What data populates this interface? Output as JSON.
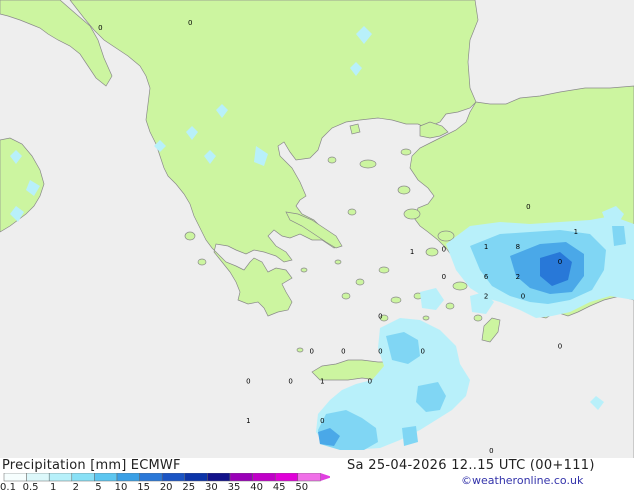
{
  "title": "Precipitation [mm]  ECMWF",
  "datetime": "Sa 25-04-2026 12..15 UTC (00+111)",
  "credit": "©weatheronline.co.uk",
  "colors": {
    "sea": "#eeeeee",
    "land": "#ccf5a0",
    "coast": "#8a8a8a",
    "precip_light": "#b8f0fa",
    "precip_medium": "#80d6f4",
    "precip_strong": "#4aa8e8",
    "precip_heavy": "#2878d8"
  },
  "legend": {
    "labels": [
      "0.1",
      "0.5",
      "1",
      "2",
      "5",
      "10",
      "15",
      "20",
      "25",
      "30",
      "35",
      "40",
      "45",
      "50"
    ],
    "colors": [
      "#f6fefe",
      "#dcf8fb",
      "#b6f0fa",
      "#88e0f6",
      "#5cc6f0",
      "#3aa0e6",
      "#2a78d8",
      "#1a54c4",
      "#0c34a8",
      "#12128a",
      "#9a00b8",
      "#c000c8",
      "#e000d8",
      "#f070e8"
    ]
  },
  "point_values": [
    {
      "label": "1",
      "lon": 25.9,
      "lat": 37.5
    },
    {
      "label": "0",
      "lon": 26.5,
      "lat": 37.55
    },
    {
      "label": "1",
      "lon": 27.3,
      "lat": 37.6
    },
    {
      "label": "8",
      "lon": 27.9,
      "lat": 37.6
    },
    {
      "label": "6",
      "lon": 27.3,
      "lat": 37.0
    },
    {
      "label": "2",
      "lon": 27.9,
      "lat": 37.0
    },
    {
      "label": "0",
      "lon": 26.5,
      "lat": 37.0
    },
    {
      "label": "2",
      "lon": 27.3,
      "lat": 36.6
    },
    {
      "label": "0",
      "lon": 28.0,
      "lat": 36.6
    },
    {
      "label": "0",
      "lon": 25.3,
      "lat": 36.2
    },
    {
      "label": "0",
      "lon": 24.0,
      "lat": 35.5
    },
    {
      "label": "0",
      "lon": 24.6,
      "lat": 35.5
    },
    {
      "label": "0",
      "lon": 25.3,
      "lat": 35.5
    },
    {
      "label": "0",
      "lon": 22.8,
      "lat": 34.9
    },
    {
      "label": "0",
      "lon": 23.6,
      "lat": 34.9
    },
    {
      "label": "1",
      "lon": 24.2,
      "lat": 34.9
    },
    {
      "label": "0",
      "lon": 25.1,
      "lat": 34.9
    },
    {
      "label": "1",
      "lon": 22.8,
      "lat": 34.1
    },
    {
      "label": "0",
      "lon": 24.2,
      "lat": 34.1
    },
    {
      "label": "0",
      "lon": 26.1,
      "lat": 35.5
    },
    {
      "label": "0",
      "lon": 28.7,
      "lat": 35.6
    },
    {
      "label": "0",
      "lon": 28.7,
      "lat": 37.3
    },
    {
      "label": "1",
      "lon": 29.0,
      "lat": 37.9
    },
    {
      "label": "0",
      "lon": 20.0,
      "lat": 42.0
    },
    {
      "label": "0",
      "lon": 21.7,
      "lat": 42.1
    },
    {
      "label": "0",
      "lon": 28.1,
      "lat": 38.4
    },
    {
      "label": "0",
      "lon": 27.4,
      "lat": 33.5
    }
  ]
}
